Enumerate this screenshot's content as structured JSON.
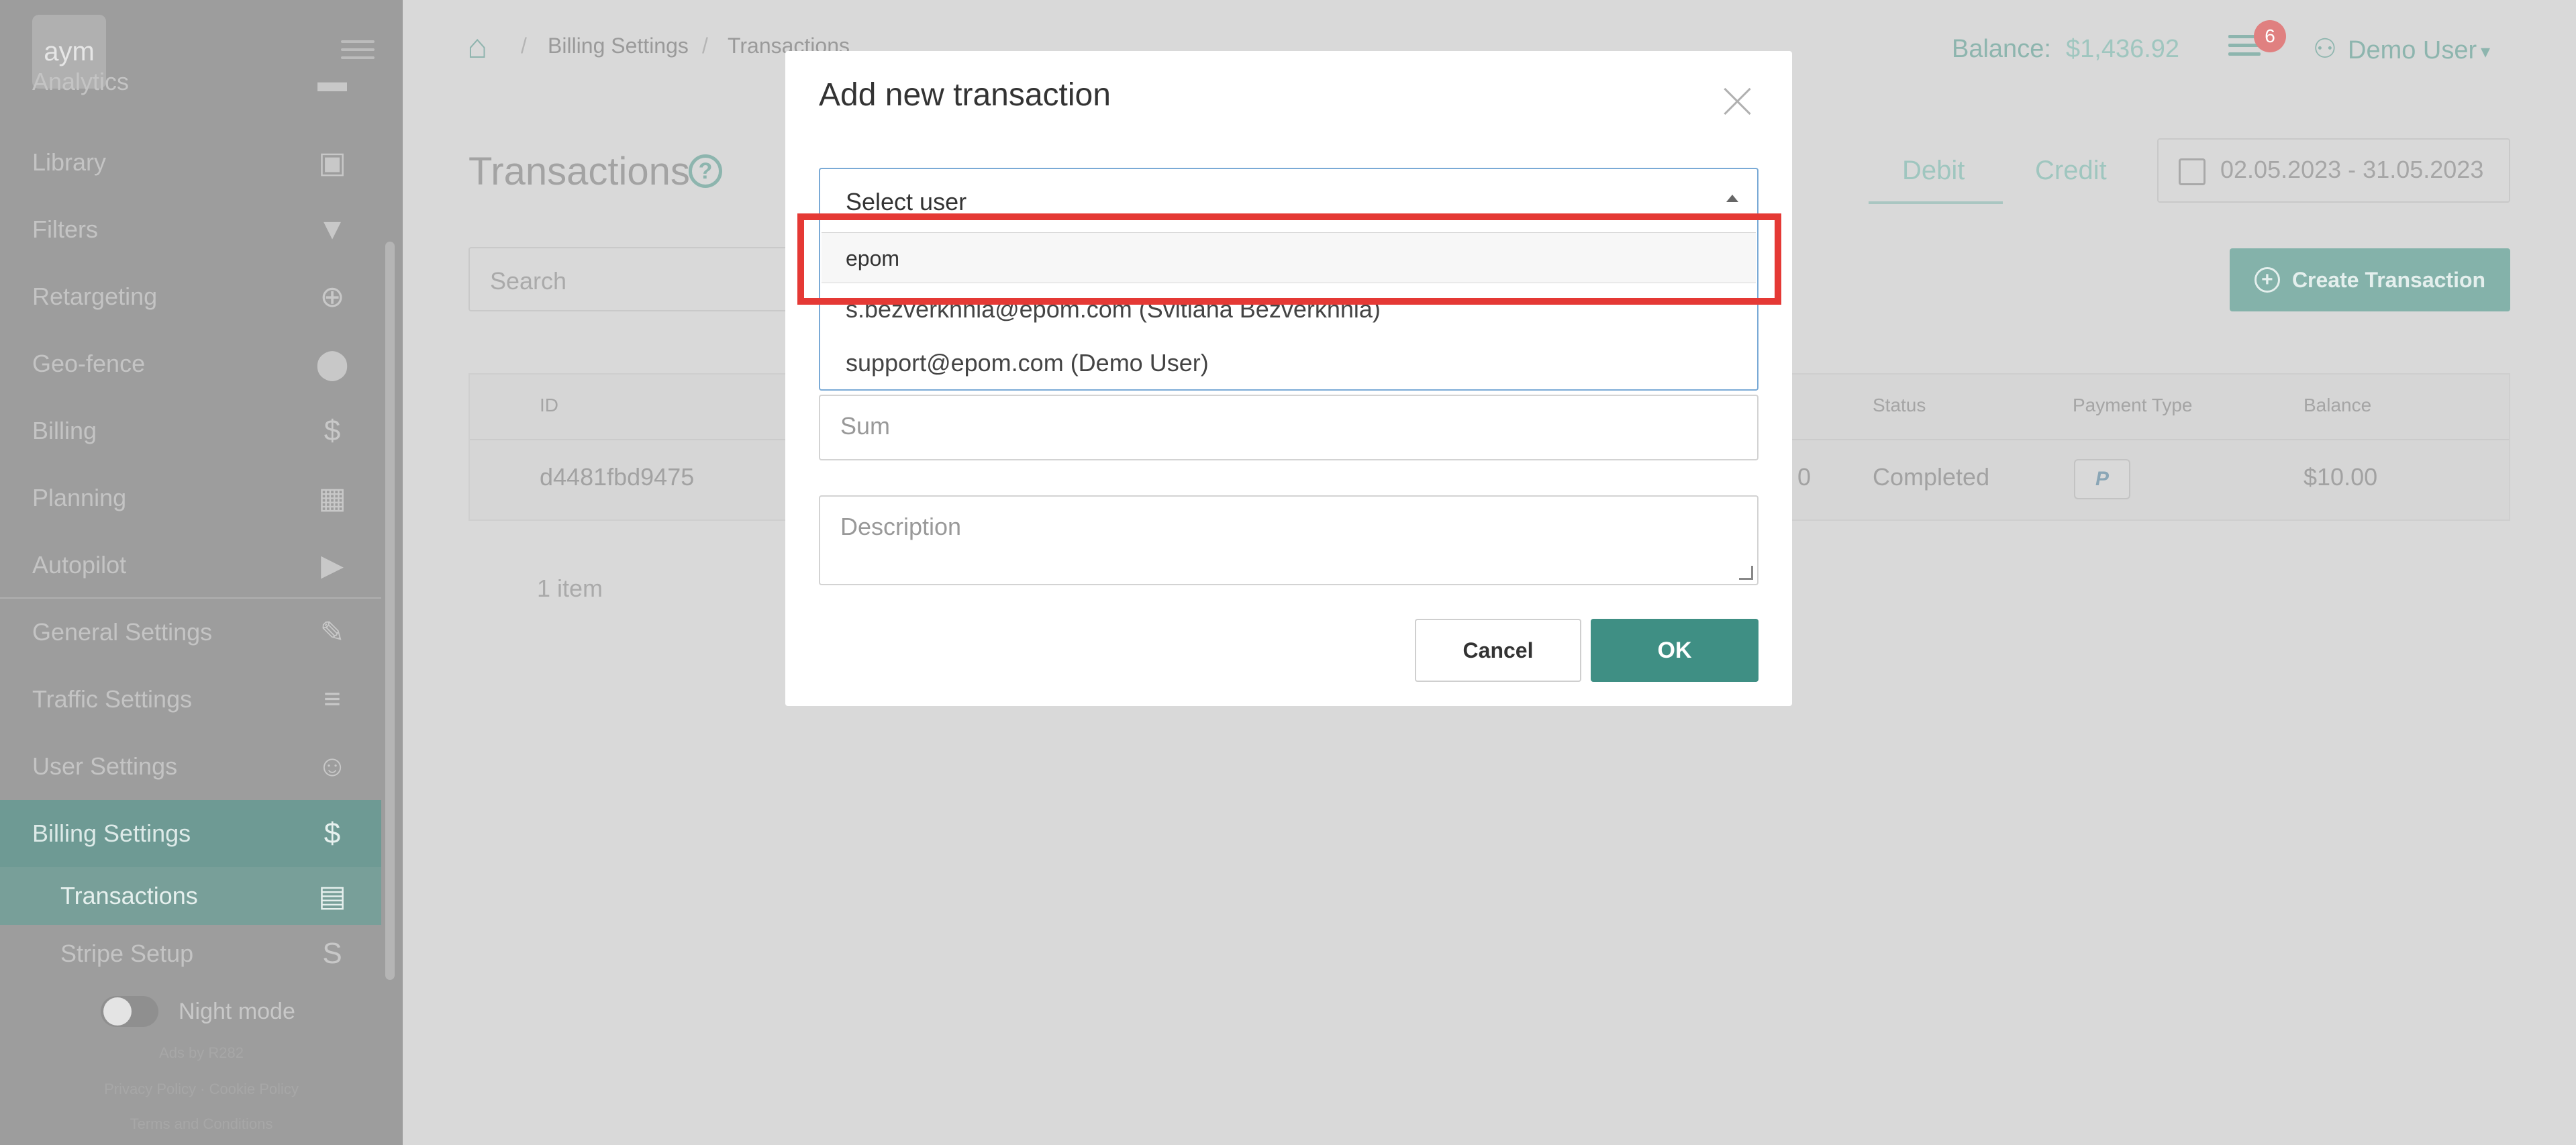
{
  "sidebar": {
    "logo": "aym",
    "items": [
      {
        "label": "Analytics"
      },
      {
        "label": "Library"
      },
      {
        "label": "Filters"
      },
      {
        "label": "Retargeting"
      },
      {
        "label": "Geo-fence"
      },
      {
        "label": "Billing"
      },
      {
        "label": "Planning"
      },
      {
        "label": "Autopilot"
      },
      {
        "label": "General Settings"
      },
      {
        "label": "Traffic Settings"
      },
      {
        "label": "User Settings"
      },
      {
        "label": "Billing Settings"
      },
      {
        "label": "Transactions"
      },
      {
        "label": "Stripe Setup"
      }
    ],
    "night_mode": "Night mode",
    "footer": [
      "Ads by R282",
      "Privacy Policy · Cookie Policy",
      "Terms and Conditions"
    ]
  },
  "topbar": {
    "breadcrumbs": [
      "Billing Settings",
      "Transactions"
    ],
    "balance_label": "Balance:",
    "balance_value": "$1,436.92",
    "notification_count": "6",
    "user_name": "Demo User"
  },
  "page": {
    "title": "Transactions",
    "tabs": [
      "Debit",
      "Credit"
    ],
    "date_range": "02.05.2023 - 31.05.2023",
    "search_placeholder": "Search",
    "create_button": "Create Transaction",
    "table": {
      "headers": {
        "id": "ID",
        "status": "Status",
        "payment_type": "Payment Type",
        "balance": "Balance"
      },
      "rows": [
        {
          "id": "d4481fbd9475",
          "amount_fragment": "0",
          "status": "Completed",
          "payment_type": "P",
          "balance": "$10.00"
        }
      ]
    },
    "items_count": "1 item"
  },
  "modal": {
    "title": "Add new transaction",
    "select_label": "Select user",
    "search_value": "epom",
    "options": [
      "s.bezverkhnia@epom.com (Svitlana Bezverkhnia)",
      "support@epom.com (Demo User)"
    ],
    "sum_placeholder": "Sum",
    "description_placeholder": "Description",
    "cancel_label": "Cancel",
    "ok_label": "OK"
  },
  "colors": {
    "accent": "#3f8f84",
    "highlight": "#e53935",
    "select_border": "#7aaad6"
  }
}
